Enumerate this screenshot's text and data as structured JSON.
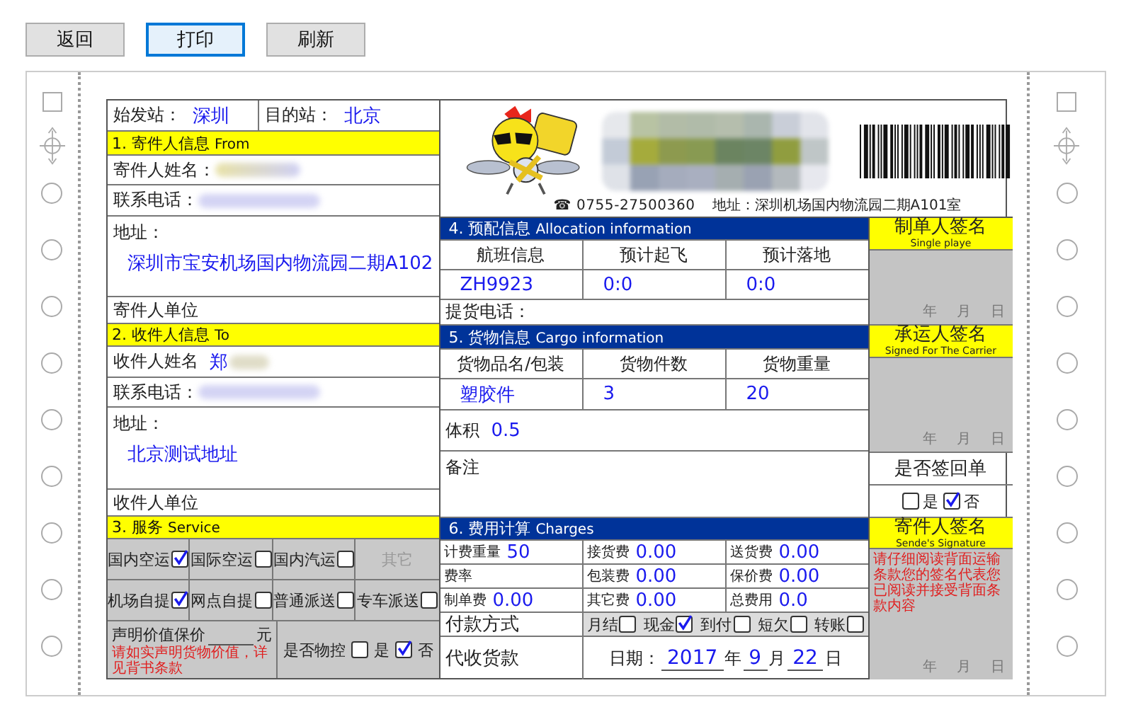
{
  "toolbar": [
    {
      "label": "返回",
      "selected": false
    },
    {
      "label": "打印",
      "selected": true
    },
    {
      "label": "刷新",
      "selected": false
    }
  ],
  "route": {
    "origin_label": "始发站：",
    "origin": "深圳",
    "dest_label": "目的站：",
    "dest": "北京"
  },
  "sender": {
    "title": "1. 寄件人信息",
    "title_en": "From",
    "name_label": "寄件人姓名：",
    "phone_label": "联系电话：",
    "address_label": "地址：",
    "address": "深圳市宝安机场国内物流园二期A102",
    "company_label": "寄件人单位"
  },
  "receiver": {
    "title": "2. 收件人信息",
    "title_en": "To",
    "name_label": "收件人姓名",
    "name": "郑",
    "phone_label": "联系电话：",
    "address_label": "地址：",
    "address": "北京测试地址",
    "company_label": "收件人单位"
  },
  "service": {
    "title": "3. 服务",
    "title_en": "Service",
    "options": [
      {
        "label": "国内空运",
        "kind": "check",
        "checked": true
      },
      {
        "label": "国际空运",
        "kind": "check",
        "checked": false
      },
      {
        "label": "国内汽运",
        "kind": "check",
        "checked": false
      },
      {
        "label": "其它",
        "kind": "disabled"
      },
      {
        "label": "机场自提",
        "kind": "check",
        "checked": true
      },
      {
        "label": "网点自提",
        "kind": "check",
        "checked": false
      },
      {
        "label": "普通派送",
        "kind": "check",
        "checked": false
      },
      {
        "label": "专车派送",
        "kind": "check",
        "checked": false
      }
    ],
    "declared_label": "声明价值保价",
    "declared_unit": "元",
    "declared_note": "请如实声明货物价值，详见背书条款",
    "control_label": "是否物控",
    "control_options": [
      {
        "label": "是",
        "checked": false
      },
      {
        "label": "否",
        "checked": true
      }
    ]
  },
  "header": {
    "phone_icon": "☎",
    "phone": "0755-27500360",
    "address": "地址：深圳机场国内物流园二期A101室"
  },
  "allocation": {
    "title": "4. 预配信息",
    "title_en": "Allocation  information",
    "columns": [
      "航班信息",
      "预计起飞",
      "预计落地"
    ],
    "values": [
      "ZH9923",
      "0:0",
      "0:0"
    ],
    "pickup_phone_label": "提货电话："
  },
  "cargo": {
    "title": "5. 货物信息",
    "title_en": "Cargo information",
    "columns": [
      "货物品名/包装",
      "货物件数",
      "货物重量"
    ],
    "values": [
      "塑胶件",
      "3",
      "20"
    ],
    "volume_label": "体积",
    "volume": "0.5",
    "remarks_label": "备注"
  },
  "charges": {
    "title": "6. 费用计算",
    "title_en": "Charges",
    "items": [
      {
        "label": "计费重量",
        "value": "50"
      },
      {
        "label": "接货费",
        "value": "0.00"
      },
      {
        "label": "送货费",
        "value": "0.00"
      },
      {
        "label": "费率"
      },
      {
        "label": "包装费",
        "value": "0.00"
      },
      {
        "label": "保价费",
        "value": "0.00"
      },
      {
        "label": "制单费",
        "value": "0.00"
      },
      {
        "label": "其它费",
        "value": "0.00"
      },
      {
        "label": "总费用",
        "value": "0.0"
      }
    ],
    "payment_label": "付款方式",
    "payment_options": [
      {
        "label": "月结",
        "checked": false
      },
      {
        "label": "现金",
        "checked": true
      },
      {
        "label": "到付",
        "checked": false
      },
      {
        "label": "短欠",
        "checked": false
      },
      {
        "label": "转账",
        "checked": false
      }
    ],
    "cod_label": "代收货款",
    "date_label": "日期：",
    "year": "2017",
    "year_unit": "年",
    "month": "9",
    "month_unit": "月",
    "day": "22",
    "day_unit": "日"
  },
  "signatures": [
    {
      "title": "制单人签名",
      "subtitle": "Single playe",
      "date_units": [
        "年",
        "月",
        "日"
      ]
    },
    {
      "title": "承运人签名",
      "subtitle": "Signed For The Carrier",
      "date_units": [
        "年",
        "月",
        "日"
      ]
    },
    {
      "title": "寄件人签名",
      "subtitle": "Sende's Signature",
      "note": "请仔细阅读背面运输条款您的签名代表您已阅读并接受背面条款内容",
      "date_units": [
        "年",
        "月",
        "日"
      ]
    }
  ],
  "return_receipt": {
    "title": "是否签回单",
    "options": [
      {
        "label": "是",
        "checked": false
      },
      {
        "label": "否",
        "checked": true
      }
    ]
  }
}
